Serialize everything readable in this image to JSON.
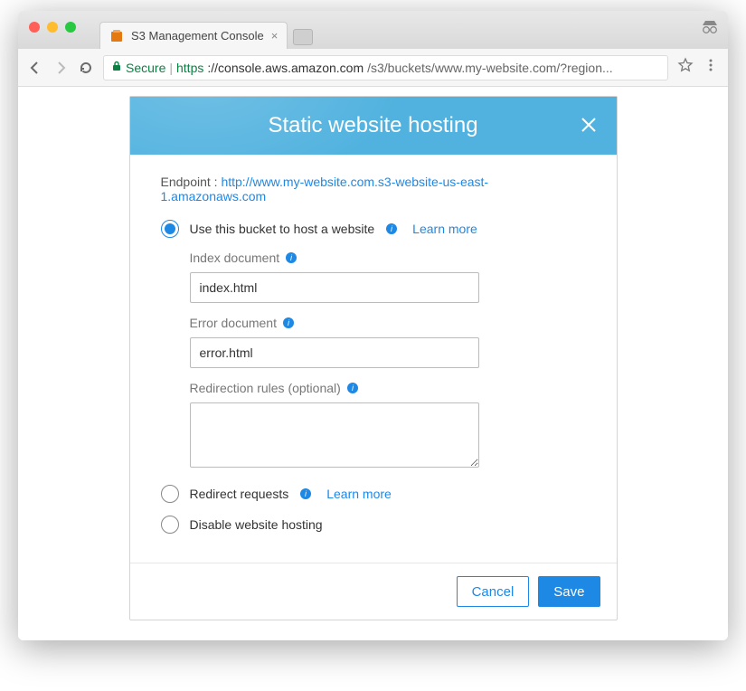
{
  "browser": {
    "tab_title": "S3 Management Console",
    "secure_label": "Secure",
    "url_scheme": "https",
    "url_host": "://console.aws.amazon.com",
    "url_path": "/s3/buckets/www.my-website.com/?region..."
  },
  "panel": {
    "title": "Static website hosting",
    "endpoint_label": "Endpoint : ",
    "endpoint_url": "http://www.my-website.com.s3-website-us-east-1.amazonaws.com",
    "options": {
      "host": {
        "label": "Use this bucket to host a website",
        "learn_more": "Learn more"
      },
      "redirect": {
        "label": "Redirect requests",
        "learn_more": "Learn more"
      },
      "disable": {
        "label": "Disable website hosting"
      }
    },
    "fields": {
      "index_label": "Index document",
      "index_value": "index.html",
      "error_label": "Error document",
      "error_value": "error.html",
      "redirect_label": "Redirection rules (optional)",
      "redirect_value": ""
    },
    "buttons": {
      "cancel": "Cancel",
      "save": "Save"
    }
  }
}
